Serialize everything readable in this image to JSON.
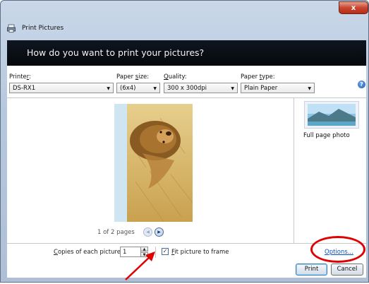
{
  "window": {
    "title": "Print Pictures",
    "close_label": "x"
  },
  "header": {
    "question": "How do you want to print your pictures?"
  },
  "settings": {
    "printer": {
      "label_pre": "Printe",
      "label_accel": "r",
      "label_post": ":",
      "value": "DS-RX1"
    },
    "paper_size": {
      "label_pre": "Paper ",
      "label_accel": "s",
      "label_post": "ize:",
      "value": "(6x4)"
    },
    "quality": {
      "label_pre": "",
      "label_accel": "Q",
      "label_post": "uality:",
      "value": "300 x 300dpi"
    },
    "paper_type": {
      "label_pre": "Paper ",
      "label_accel": "t",
      "label_post": "ype:",
      "value": "Plain Paper"
    },
    "help_icon": "help-icon"
  },
  "preview": {
    "page_count": "1 of 2 pages",
    "prev_icon": "arrow-left-icon",
    "next_icon": "arrow-right-icon"
  },
  "layouts": [
    {
      "label": "Full page photo",
      "selected": true
    }
  ],
  "bottom": {
    "copies_label_accel": "C",
    "copies_label_rest": "opies of each picture:",
    "copies_value": "1",
    "fit_checked": true,
    "fit_label_accel": "F",
    "fit_label_rest": "it picture to frame",
    "options_link": "Options...",
    "print_button": "Print",
    "cancel_button": "Cancel"
  },
  "colors": {
    "annotation_red": "#e00000",
    "link_blue": "#0a4fc4",
    "header_dark": "#05080c"
  }
}
